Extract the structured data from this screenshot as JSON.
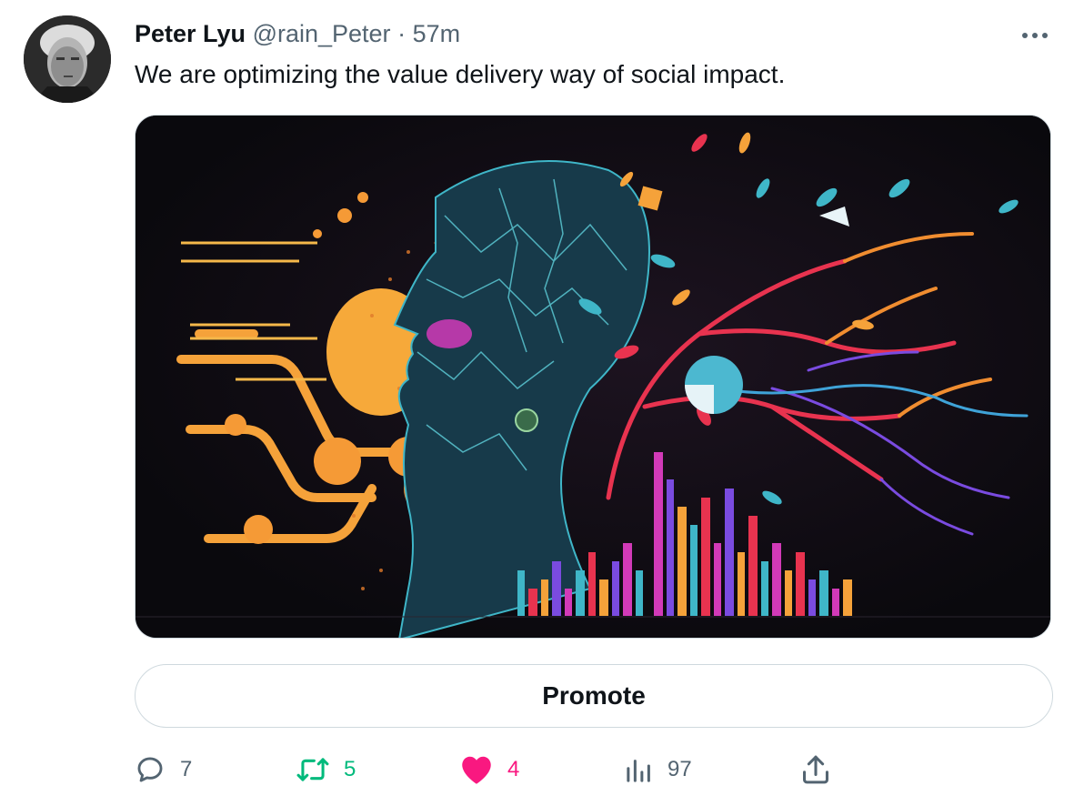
{
  "tweet": {
    "author_name": "Peter Lyu",
    "author_handle": "@rain_Peter",
    "separator": "·",
    "time": "57m",
    "text": "We are optimizing the value delivery way of social impact."
  },
  "promote_label": "Promote",
  "actions": {
    "replies": "7",
    "retweets": "5",
    "likes": "4",
    "views": "97"
  },
  "icons": {
    "more": "more-horizontal-icon",
    "reply": "reply-icon",
    "retweet": "retweet-icon",
    "like": "heart-filled-icon",
    "views": "analytics-bar-icon",
    "share": "share-upload-icon"
  },
  "colors": {
    "text_primary": "#0f1419",
    "text_secondary": "#536471",
    "retweet": "#00ba7c",
    "like": "#f91880",
    "border": "#cfd9de"
  }
}
